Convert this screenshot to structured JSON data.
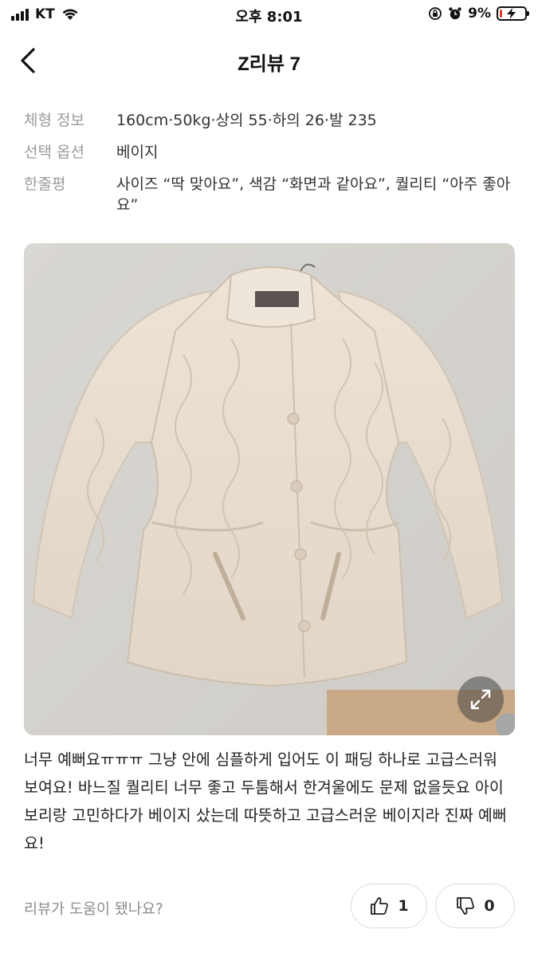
{
  "status_bar": {
    "carrier": "KT",
    "time": "오후 8:01",
    "battery": "9%",
    "battery_level": 0.09,
    "battery_color": "#e23a2f"
  },
  "header": {
    "title": "Z리뷰 7",
    "back_icon": "chevron-left-icon"
  },
  "info": [
    {
      "label": "체형 정보",
      "value": "160cm·50kg·상의 55·하의 26·발 235"
    },
    {
      "label": "선택 옵션",
      "value": "베이지"
    },
    {
      "label": "한줄평",
      "value": "사이즈 “딱 맞아요”, 색감 “화면과 같아요”, 퀄리티 “아주 좋아요”"
    }
  ],
  "photo": {
    "subject": "beige quilted jacket",
    "expand_icon": "expand-icon"
  },
  "review": {
    "text": "너무 예뻐요ㅠㅠㅠ 그냥 안에 심플하게 입어도 이 패딩 하나로 고급스러워 보여요! 바느질 퀄리티 너무 좋고 두툼해서 한겨울에도 문제 없을듯요 아이보리랑 고민하다가 베이지 샀는데 따뜻하고 고급스러운 베이지라 진짜 예뻐요!"
  },
  "helpful": {
    "question": "리뷰가 도움이 됐나요?",
    "up_count": "1",
    "down_count": "0",
    "up_icon": "thumbs-up-icon",
    "down_icon": "thumbs-down-icon"
  }
}
